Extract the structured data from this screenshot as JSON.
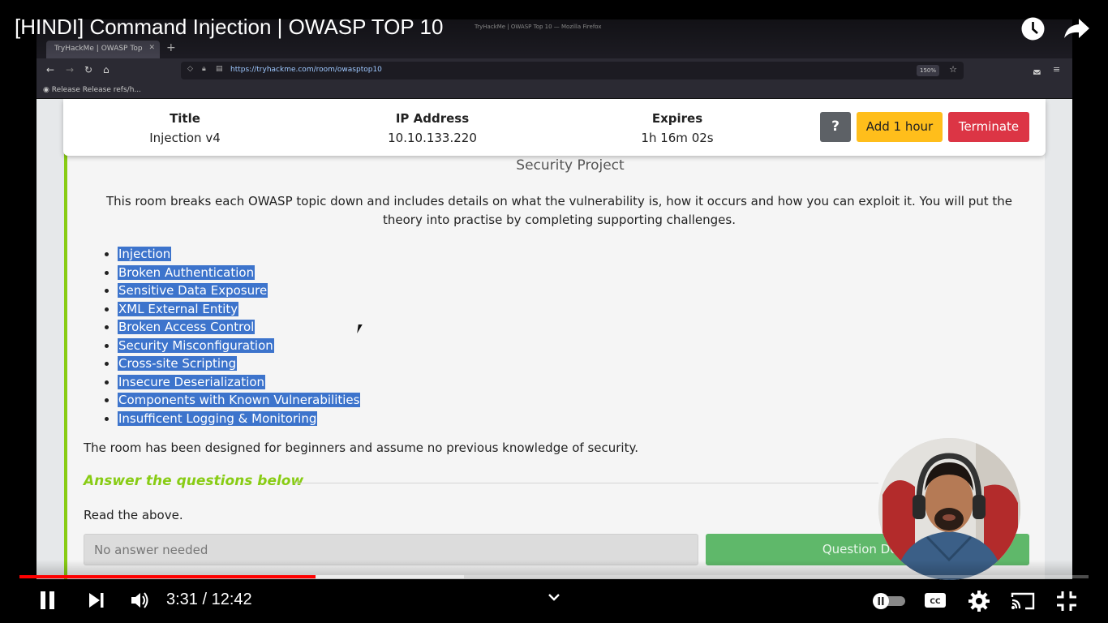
{
  "video": {
    "title": "[HINDI] Command Injection | OWASP TOP 10",
    "current_time": "3:31",
    "time_separator": "/",
    "duration": "12:42",
    "progress_played_fraction": 0.277,
    "progress_buffered_fraction": 0.416,
    "accent_color": "#ff0000"
  },
  "browser": {
    "window_title": "TryHackMe | OWASP Top 10 — Mozilla Firefox",
    "tab_label": "TryHackMe | OWASP Top",
    "new_tab": "+",
    "url": "https://tryhackme.com/room/owasptop10",
    "zoom": "150%",
    "bookmark": "Release Release refs/h..."
  },
  "machine": {
    "title_label": "Title",
    "title_value": "Injection v4",
    "ip_label": "IP Address",
    "ip_value": "10.10.133.220",
    "expires_label": "Expires",
    "expires_value": "1h 16m 02s",
    "help_label": "?",
    "add_label": "Add 1 hour",
    "terminate_label": "Terminate"
  },
  "page": {
    "logo_subtitle": "Security Project",
    "intro": "This room breaks each OWASP topic down and includes details on what the vulnerability is, how it occurs and how you can exploit it. You will put the theory into practise by completing supporting challenges.",
    "topics": [
      "Injection",
      "Broken Authentication",
      "Sensitive Data Exposure",
      "XML External Entity",
      "Broken Access Control",
      "Security Misconfiguration",
      "Cross-site Scripting",
      "Insecure Deserialization",
      "Components with Known Vulnerabilities",
      "Insufficent Logging & Monitoring"
    ],
    "note": "The room has been designed for beginners and assume no previous knowledge of security.",
    "answer_heading": "Answer the questions below",
    "question": "Read the above.",
    "answer_placeholder": "No answer needed",
    "submit_label": "Question Done",
    "accent_color": "#88cc14"
  }
}
